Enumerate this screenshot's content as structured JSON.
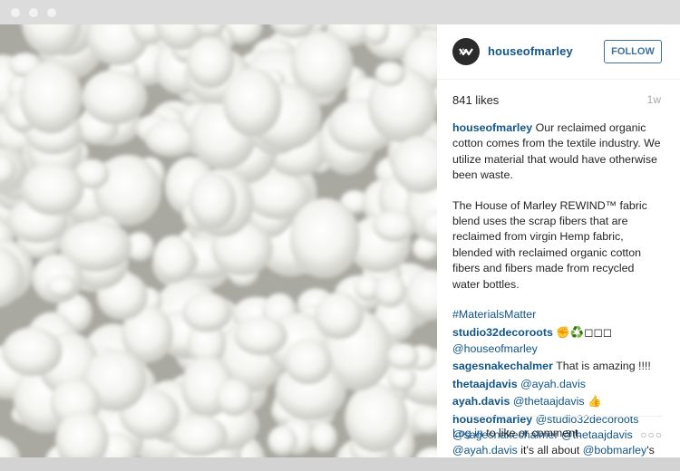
{
  "post": {
    "username": "houseofmarley",
    "follow_label": "FOLLOW",
    "likes": "841 likes",
    "time": "1w",
    "caption_user": "houseofmarley",
    "caption_p1": " Our reclaimed organic cotton comes from the textile industry. We utilize material that would have otherwise been waste.",
    "caption_p2": "The House of Marley REWIND™ fabric blend uses the scrap fibers that are reclaimed from virgin Hemp fabric, blended with reclaimed organic cotton fibers and fibers made from recycled water bottles.",
    "hashtag": "#MaterialsMatter"
  },
  "comments": [
    {
      "user": "studio32decoroots",
      "before": "",
      "mention": "",
      "text": " ✊♻️◻◻◻ ",
      "mention2": "@houseofmarley",
      "after": ""
    },
    {
      "user": "sagesnakechalmer",
      "before": "",
      "mention": "",
      "text": " That is amazing !!!!",
      "mention2": "",
      "after": ""
    },
    {
      "user": "thetaajdavis",
      "before": "",
      "mention": "",
      "text": " ",
      "mention2": "@ayah.davis",
      "after": ""
    },
    {
      "user": "ayah.davis",
      "before": "",
      "mention": "",
      "text": " ",
      "mention2": "@thetaajdavis",
      "after": " 👍"
    }
  ],
  "last_comment": {
    "user": "houseofmarley",
    "m1": "@studio32decoroots",
    "m2": "@sagesnakechalmer",
    "m3": "@thetaajdavis",
    "m4": "@ayah.davis",
    "text": " it's all about ",
    "m5": "@bobmarley",
    "tail": "'s"
  },
  "footer": {
    "login": "Log in",
    "rest": " to like or comment.",
    "more": "○○○"
  },
  "colors": {
    "link": "#125688",
    "follow_border": "#3f729b",
    "text": "#262626",
    "muted": "#a5a7aa"
  },
  "icons": {
    "avatar": "marley-logo-icon",
    "more": "more-options-icon"
  }
}
